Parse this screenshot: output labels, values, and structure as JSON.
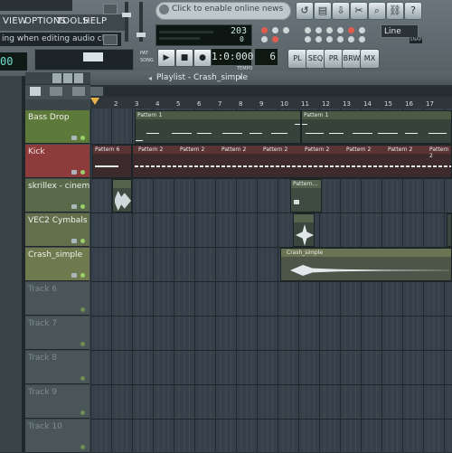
{
  "menu": {
    "items": [
      "VIEW",
      "OPTIONS",
      "TOOLS",
      "HELP"
    ]
  },
  "hint_text": "ing when editing audio clips",
  "left_lcd": "00",
  "news_text": "Click to enable online news",
  "cpu": {
    "value": "203",
    "value2": "0"
  },
  "snap": {
    "select": "Line",
    "label": "SNAP"
  },
  "time_display": "1:0:000",
  "tempo_value": "6",
  "tempo_label": "TEMPO",
  "pat_labels": {
    "pat": "PAT",
    "song": "SONG"
  },
  "view_buttons": [
    "PL",
    "SEQ",
    "PR",
    "BRW",
    "MX"
  ],
  "playlist": {
    "title": "Playlist - Crash_simple",
    "tools": [
      "ZERO CROSS",
      "STRETCH"
    ]
  },
  "ruler": [
    "2",
    "3",
    "4",
    "5",
    "6",
    "7",
    "8",
    "9",
    "10",
    "11",
    "12",
    "13",
    "14",
    "15",
    "16",
    "17"
  ],
  "tracks": [
    {
      "name": "Bass Drop",
      "color": "#5e7a3b"
    },
    {
      "name": "Kick",
      "color": "#8e3b3b"
    },
    {
      "name": "skrillex - cinem...",
      "color": "#586a4a"
    },
    {
      "name": "VEC2 Cymbals ...",
      "color": "#64704d"
    },
    {
      "name": "Crash_simple",
      "color": "#707a4f"
    },
    {
      "name": "Track 6",
      "color": "#4a5558"
    },
    {
      "name": "Track 7",
      "color": "#4a5558"
    },
    {
      "name": "Track 8",
      "color": "#4a5558"
    },
    {
      "name": "Track 9",
      "color": "#4a5558"
    },
    {
      "name": "Track 10",
      "color": "#4a5558"
    }
  ],
  "clips": {
    "pattern1": "Pattern 1",
    "pattern6": "Pattern 6",
    "pattern2": "Pattern 2",
    "pattern_cut": "Pattern...",
    "crash": "Crash_simple"
  }
}
